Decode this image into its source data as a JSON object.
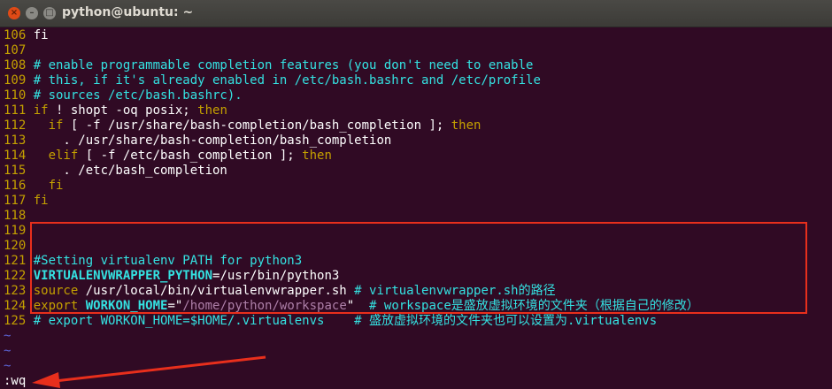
{
  "window": {
    "title": "python@ubuntu: ~",
    "buttons": {
      "close": "×",
      "minimize": "–",
      "maximize": "□"
    }
  },
  "editor": {
    "lines": [
      {
        "num": "106",
        "segs": [
          {
            "t": "fi",
            "c": "fg"
          }
        ]
      },
      {
        "num": "107",
        "segs": []
      },
      {
        "num": "108",
        "segs": [
          {
            "t": "# enable programmable completion features (you don't need to enable",
            "c": "cm"
          }
        ]
      },
      {
        "num": "109",
        "segs": [
          {
            "t": "# this, if it's already enabled in /etc/bash.bashrc and /etc/profile",
            "c": "cm"
          }
        ]
      },
      {
        "num": "110",
        "segs": [
          {
            "t": "# sources /etc/bash.bashrc).",
            "c": "cm"
          }
        ]
      },
      {
        "num": "111",
        "segs": [
          {
            "t": "if",
            "c": "kw"
          },
          {
            "t": " ! shopt -oq posix; ",
            "c": "fg"
          },
          {
            "t": "then",
            "c": "kw"
          }
        ]
      },
      {
        "num": "112",
        "segs": [
          {
            "t": "  if",
            "c": "kw"
          },
          {
            "t": " [ -f /usr/share/bash-completion/bash_completion ]; ",
            "c": "fg"
          },
          {
            "t": "then",
            "c": "kw"
          }
        ]
      },
      {
        "num": "113",
        "segs": [
          {
            "t": "    . /usr/share/bash-completion/bash_completion",
            "c": "fg"
          }
        ]
      },
      {
        "num": "114",
        "segs": [
          {
            "t": "  elif",
            "c": "kw"
          },
          {
            "t": " [ -f /etc/bash_completion ]; ",
            "c": "fg"
          },
          {
            "t": "then",
            "c": "kw"
          }
        ]
      },
      {
        "num": "115",
        "segs": [
          {
            "t": "    . /etc/bash_completion",
            "c": "fg"
          }
        ]
      },
      {
        "num": "116",
        "segs": [
          {
            "t": "  fi",
            "c": "kw"
          }
        ]
      },
      {
        "num": "117",
        "segs": [
          {
            "t": "fi",
            "c": "kw"
          }
        ]
      },
      {
        "num": "118",
        "segs": []
      },
      {
        "num": "119",
        "segs": []
      },
      {
        "num": "120",
        "segs": []
      },
      {
        "num": "121",
        "segs": [
          {
            "t": "#Setting virtualenv PATH for python3",
            "c": "cm"
          }
        ]
      },
      {
        "num": "122",
        "segs": [
          {
            "t": "VIRTUALENVWRAPPER_PYTHON",
            "c": "var"
          },
          {
            "t": "=/usr/bin/python3",
            "c": "fg"
          }
        ]
      },
      {
        "num": "123",
        "segs": [
          {
            "t": "source",
            "c": "kw"
          },
          {
            "t": " /usr/local/bin/virtualenvwrapper.sh ",
            "c": "fg"
          },
          {
            "t": "# virtualenvwrapper.sh的路径",
            "c": "cm"
          }
        ]
      },
      {
        "num": "124",
        "segs": [
          {
            "t": "export",
            "c": "kw"
          },
          {
            "t": " ",
            "c": "fg"
          },
          {
            "t": "WORKON_HOME",
            "c": "var"
          },
          {
            "t": "=\"",
            "c": "fg"
          },
          {
            "t": "/home/python/workspace",
            "c": "str"
          },
          {
            "t": "\"  ",
            "c": "fg"
          },
          {
            "t": "# workspace是盛放虚拟环境的文件夹（根据自己的修改）",
            "c": "cm"
          }
        ]
      },
      {
        "num": "125",
        "segs": [
          {
            "t": "# export WORKON_HOME=$HOME/.virtualenvs    # 盛放虚拟环境的文件夹也可以设置为.virtualenvs",
            "c": "cm"
          }
        ]
      }
    ],
    "tildes": [
      "~",
      "~",
      "~"
    ],
    "command": ":wq"
  },
  "annotation": {
    "box_color": "#e82f1c",
    "arrow_color": "#e82f1c"
  }
}
